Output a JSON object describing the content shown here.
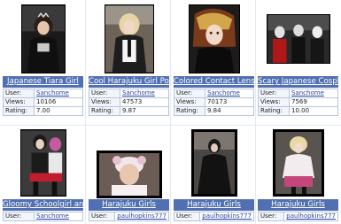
{
  "gallery": {
    "row1": [
      {
        "title": "Japanese Tiara Girl",
        "user_label": "User:",
        "user": "Sanchome",
        "views_label": "Views:",
        "views": "10106",
        "rating_label": "Rating:",
        "rating": "7.00"
      },
      {
        "title": "Cool Harajuku Girl Pos...",
        "user_label": "User:",
        "user": "Sanchome",
        "views_label": "Views:",
        "views": "47573",
        "rating_label": "Rating:",
        "rating": "9.87"
      },
      {
        "title": "Colored Contact Lenses...",
        "user_label": "User:",
        "user": "Sanchome",
        "views_label": "Views:",
        "views": "70173",
        "rating_label": "Rating:",
        "rating": "9.84"
      },
      {
        "title": "Scary Japanese Cosplay...",
        "user_label": "User:",
        "user": "Sanchome",
        "views_label": "Views:",
        "views": "7569",
        "rating_label": "Rating:",
        "rating": "10.00"
      }
    ],
    "row2": [
      {
        "title": "Gloomy Schoolgirl and ...",
        "user_label": "User:",
        "user": "Sanchome"
      },
      {
        "title": "Harajuku Girls",
        "user_label": "User:",
        "user": "paulhopkins777"
      },
      {
        "title": "Harajuku Girls",
        "user_label": "User:",
        "user": "paulhopkins777"
      },
      {
        "title": "Harajuku Girls",
        "user_label": "User:",
        "user": "paulhopkins777"
      }
    ]
  },
  "colors": {
    "title_bar": "#5170b3",
    "link": "#2844a0",
    "border": "#b8c4dc"
  }
}
